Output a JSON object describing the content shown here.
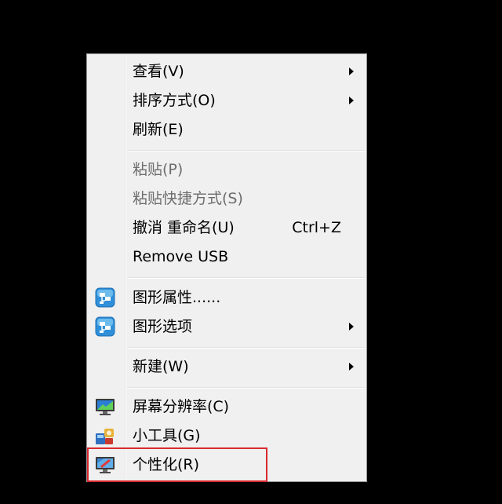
{
  "menu": {
    "items": [
      {
        "label": "查看(V)",
        "shortcut": "",
        "submenu": true,
        "disabled": false,
        "icon": ""
      },
      {
        "label": "排序方式(O)",
        "shortcut": "",
        "submenu": true,
        "disabled": false,
        "icon": ""
      },
      {
        "label": "刷新(E)",
        "shortcut": "",
        "submenu": false,
        "disabled": false,
        "icon": ""
      },
      {
        "label": "粘贴(P)",
        "shortcut": "",
        "submenu": false,
        "disabled": true,
        "icon": ""
      },
      {
        "label": "粘贴快捷方式(S)",
        "shortcut": "",
        "submenu": false,
        "disabled": true,
        "icon": ""
      },
      {
        "label": "撤消 重命名(U)",
        "shortcut": "Ctrl+Z",
        "submenu": false,
        "disabled": false,
        "icon": ""
      },
      {
        "label": "Remove USB",
        "shortcut": "",
        "submenu": false,
        "disabled": false,
        "icon": ""
      },
      {
        "label": "图形属性......",
        "shortcut": "",
        "submenu": false,
        "disabled": false,
        "icon": "graphics-properties-icon"
      },
      {
        "label": "图形选项",
        "shortcut": "",
        "submenu": true,
        "disabled": false,
        "icon": "graphics-options-icon"
      },
      {
        "label": "新建(W)",
        "shortcut": "",
        "submenu": true,
        "disabled": false,
        "icon": ""
      },
      {
        "label": "屏幕分辨率(C)",
        "shortcut": "",
        "submenu": false,
        "disabled": false,
        "icon": "screen-resolution-icon"
      },
      {
        "label": "小工具(G)",
        "shortcut": "",
        "submenu": false,
        "disabled": false,
        "icon": "gadgets-icon"
      },
      {
        "label": "个性化(R)",
        "shortcut": "",
        "submenu": false,
        "disabled": false,
        "icon": "personalize-icon"
      }
    ]
  },
  "colors": {
    "background": "#000000",
    "menu_bg": "#f0f0f0",
    "highlight": "#d9292f",
    "disabled_text": "#6d6d6d"
  }
}
